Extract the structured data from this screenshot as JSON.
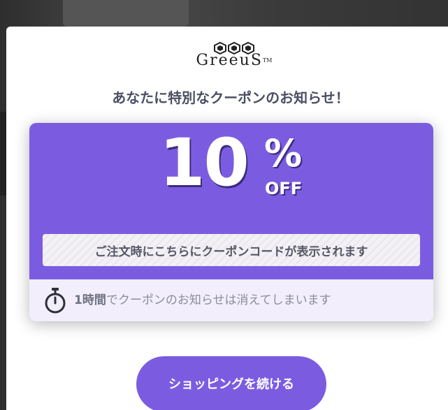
{
  "brand": {
    "logo_text": "GreeuS",
    "logo_tm": "TM"
  },
  "popup": {
    "headline": "あなたに特別なクーポンのお知らせ！",
    "discount_value": "10",
    "discount_percent": "%",
    "discount_off": "OFF",
    "code_message": "ご注文時にこちらにクーポンコードが表示されます",
    "timer_strong": "1時間",
    "timer_rest": "でクーポンのお知らせは消えてしまいます",
    "timer_icon": "stopwatch-icon",
    "continue_label": "ショッピングを続ける"
  },
  "colors": {
    "accent": "#7b5ce1",
    "coupon_footer": "#f2eefc",
    "headline": "#4a4f63"
  }
}
